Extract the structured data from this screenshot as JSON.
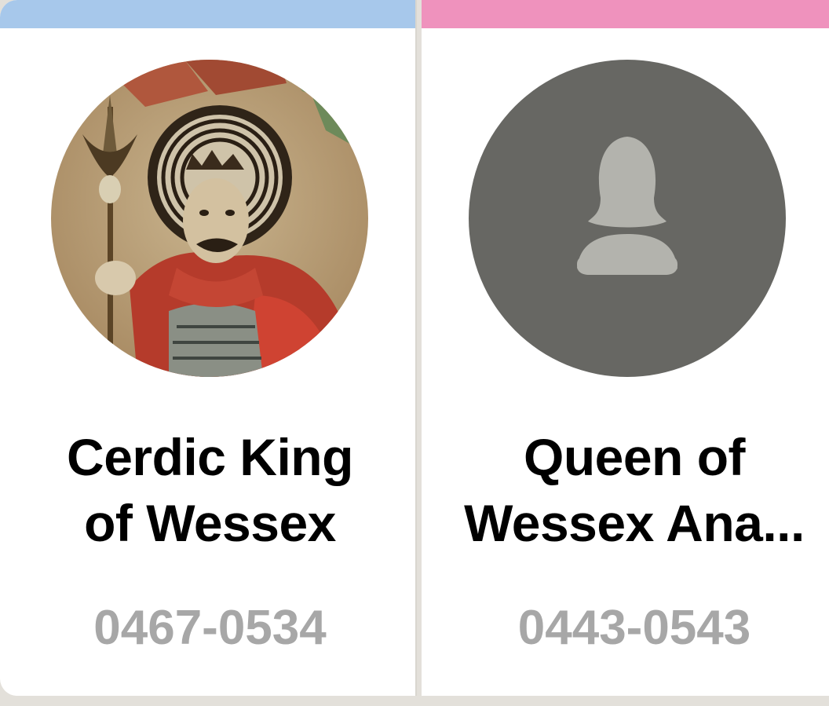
{
  "people": [
    {
      "name_line1": "Cerdic King",
      "name_line2": "of Wessex",
      "dates": "0467-0534",
      "accent_color": "#a7c8eb",
      "photo": "portrait-painting"
    },
    {
      "name_line1": "Queen of",
      "name_line2": "Wessex Ana...",
      "dates": "0443-0543",
      "accent_color": "#ef92bd",
      "photo": "female-placeholder-icon"
    }
  ],
  "colors": {
    "placeholder_bg": "#676763",
    "placeholder_icon": "#b3b3ad",
    "dates_text": "#a7a7a7"
  }
}
